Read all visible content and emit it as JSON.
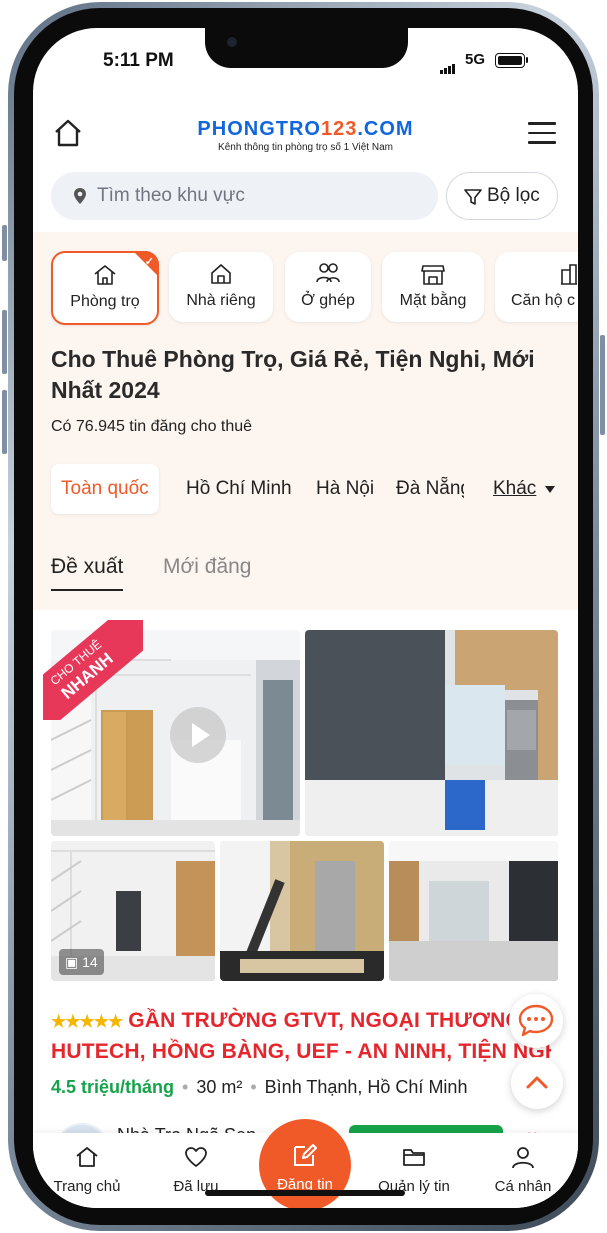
{
  "status": {
    "time": "5:11 PM",
    "network": "5G"
  },
  "header": {
    "logo_main": [
      "PHONGTRO",
      "123",
      ".",
      "COM"
    ],
    "logo_tagline": "Kênh thông tin phòng trọ số 1 Việt Nam",
    "search_placeholder": "Tìm theo khu vực",
    "filter_label": "Bộ lọc"
  },
  "categories": [
    {
      "label": "Phòng trọ",
      "icon": "home-outline-icon",
      "active": true
    },
    {
      "label": "Nhà riêng",
      "icon": "house-icon"
    },
    {
      "label": "Ở ghép",
      "icon": "people-icon"
    },
    {
      "label": "Mặt bằng",
      "icon": "storefront-icon"
    },
    {
      "label": "Căn hộ c",
      "icon": "building-icon"
    }
  ],
  "page_title": "Cho Thuê Phòng Trọ, Giá Rẻ, Tiện Nghi, Mới Nhất 2024",
  "listing_count": "Có 76.945 tin đăng cho thuê",
  "regions": [
    "Toàn quốc",
    "Hồ Chí Minh",
    "Hà Nội",
    "Đà Nẵng",
    "Khác"
  ],
  "tabs": [
    "Đề xuất",
    "Mới đăng"
  ],
  "listing": {
    "ribbon_top": "CHO THUÊ",
    "ribbon_bottom": "NHANH",
    "photo_count": "14",
    "stars": "★★★★★",
    "title_line1": "GẦN TRƯỜNG GTVT, NGOẠI THƯƠNG",
    "title_line2": "HUTECH, HỒNG BÀNG, UEF - AN NINH, TIỆN NGHI...",
    "price": "4.5 triệu/tháng",
    "area": "30 m²",
    "location": "Bình Thạnh, Hồ Chí Minh",
    "owner": "Nhà Trọ Ngõ Sen"
  },
  "bottom_nav": {
    "home": "Trang chủ",
    "saved": "Đã lưu",
    "post": "Đăng tin",
    "manage": "Quản lý tin",
    "profile": "Cá nhân"
  },
  "colors": {
    "accent": "#f05a28",
    "brand_blue": "#1266dd",
    "title_red": "#e5262d",
    "price_green": "#16a34a",
    "peach_bg": "#fdf5ef"
  }
}
